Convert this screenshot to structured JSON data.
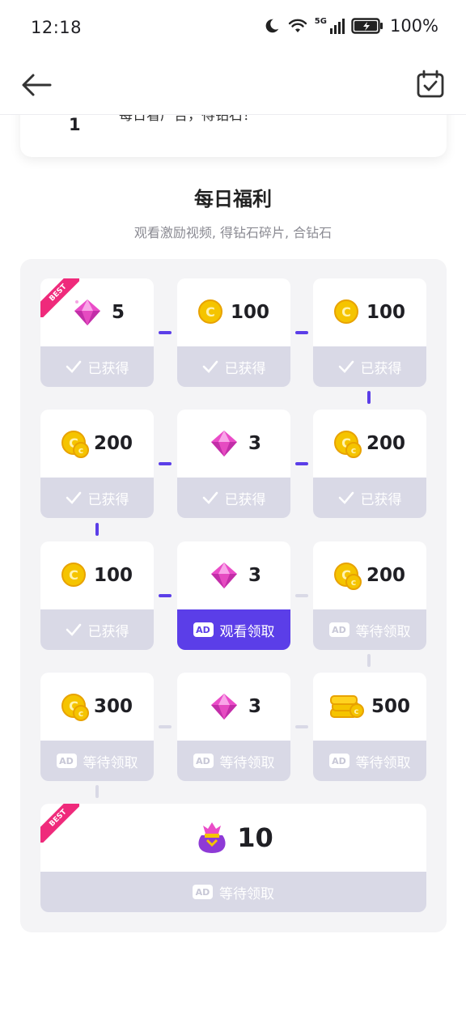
{
  "status": {
    "time": "12:18",
    "battery": "100%",
    "network": "5G"
  },
  "top_card": {
    "rank": "1",
    "desc": "每日看广告，得钻石！"
  },
  "section": {
    "title": "每日福利",
    "subtitle": "观看激励视频, 得钻石碎片, 合钻石"
  },
  "labels": {
    "claimed": "已获得",
    "watch": "观看领取",
    "waiting": "等待领取",
    "best": "BEST",
    "ad": "AD"
  },
  "rewards": [
    {
      "type": "diamond",
      "amount": "5",
      "state": "claimed",
      "best": true
    },
    {
      "type": "coin",
      "amount": "100",
      "state": "claimed"
    },
    {
      "type": "coin",
      "amount": "100",
      "state": "claimed"
    },
    {
      "type": "coins",
      "amount": "200",
      "state": "claimed"
    },
    {
      "type": "diamond",
      "amount": "3",
      "state": "claimed"
    },
    {
      "type": "coins",
      "amount": "200",
      "state": "claimed"
    },
    {
      "type": "coin",
      "amount": "100",
      "state": "claimed"
    },
    {
      "type": "diamond",
      "amount": "3",
      "state": "watch"
    },
    {
      "type": "coins",
      "amount": "200",
      "state": "waiting"
    },
    {
      "type": "coins",
      "amount": "300",
      "state": "waiting"
    },
    {
      "type": "diamond",
      "amount": "3",
      "state": "waiting"
    },
    {
      "type": "coin-stack",
      "amount": "500",
      "state": "waiting"
    },
    {
      "type": "diamond-bag",
      "amount": "10",
      "state": "waiting",
      "best": true
    }
  ],
  "colors": {
    "accent": "#5b3ee8",
    "inactive": "#d9d9e6",
    "best": "#ef2a7b",
    "gold": "#f5c400"
  }
}
